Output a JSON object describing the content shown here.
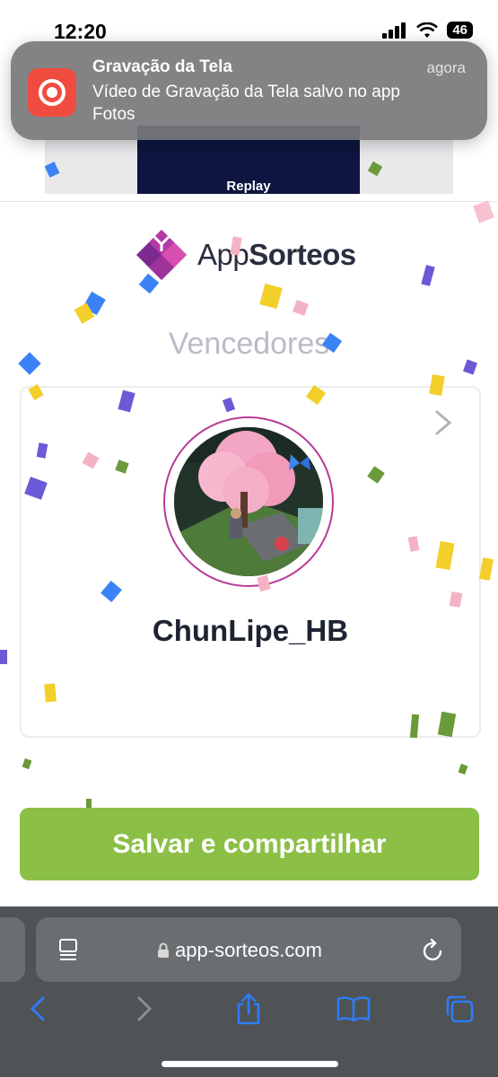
{
  "status_bar": {
    "time": "12:20",
    "battery": "46"
  },
  "notification": {
    "app_name": "Gravação da Tela",
    "time": "agora",
    "message": "Vídeo de Gravação da Tela salvo no app Fotos",
    "icon": "screen-record-icon"
  },
  "preview": {
    "label": "Replay"
  },
  "brand": {
    "logo_text_light": "App",
    "logo_text_bold": "Sorteos"
  },
  "winners": {
    "title": "Vencedores",
    "items": [
      {
        "name": "ChunLipe_HB"
      }
    ]
  },
  "actions": {
    "save_share": "Salvar e compartilhar"
  },
  "browser": {
    "url": "app-sorteos.com"
  },
  "colors": {
    "accent_green": "#8bbf46",
    "brand_purple": "#7b2a8f",
    "avatar_ring": "#b83a98",
    "notif_icon_red": "#f04b3f"
  }
}
